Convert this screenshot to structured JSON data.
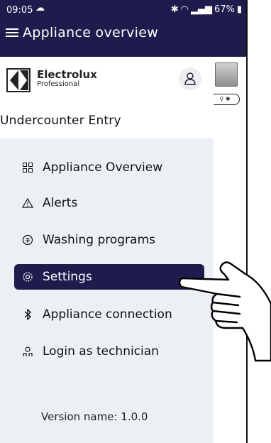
{
  "status": {
    "time": "09:05",
    "battery": "67%"
  },
  "header": {
    "title": "Appliance overview"
  },
  "brand": {
    "name": "Electrolux",
    "sub": "Professional"
  },
  "drawer": {
    "appliance_name": "Undercounter Entry",
    "items": [
      {
        "label": "Appliance Overview",
        "icon": "grid-icon"
      },
      {
        "label": "Alerts",
        "icon": "warning-icon"
      },
      {
        "label": "Washing programs",
        "icon": "program-icon"
      },
      {
        "label": "Settings",
        "icon": "gear-icon"
      },
      {
        "label": "Appliance connection",
        "icon": "bluetooth-icon"
      },
      {
        "label": "Login as technician",
        "icon": "technician-icon"
      }
    ],
    "version": "Version name: 1.0.0"
  },
  "colors": {
    "primary": "#1f1c4d",
    "drawer_bg": "#ecf0f5"
  }
}
